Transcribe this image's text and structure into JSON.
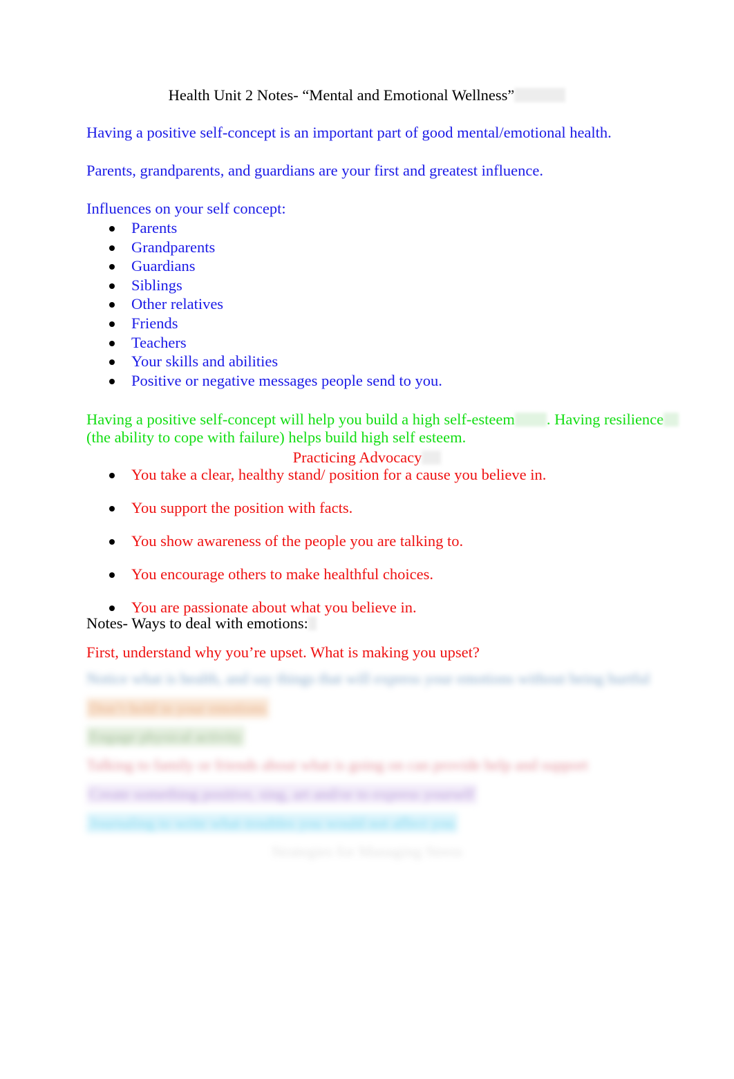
{
  "document": {
    "title": "Health Unit 2 Notes- “Mental and Emotional Wellness”",
    "intro_line": "Having a  positive self-concept    is an important part of good mental/emotional health.",
    "influence_line": "Parents, grandparents, and guardians are your first and greatest influence.",
    "influences_heading": "Influences on your self concept:",
    "influences_items": [
      "Parents",
      "Grandparents",
      "Guardians",
      "Siblings",
      "Other relatives",
      "Friends",
      "Teachers",
      "Your skills and abilities",
      "Positive or negative messages people send to you."
    ],
    "self_esteem_line_1_part_1": "Having a positive self-concept will help you build a high self-esteem",
    "self_esteem_line_1_part_2": ".  Having resilience",
    "self_esteem_line_2": "(the ability to cope with failure) helps build high self esteem.",
    "advocacy_heading": "Practicing Advocacy",
    "advocacy_items": [
      "You take a clear, healthy stand/ position for a cause you believe in.",
      "You support the position with facts.",
      "You show awareness of the people you are talking to.",
      "You encourage others to make healthful choices.",
      "You are passionate about what you believe in."
    ],
    "notes_line": "Notes-  Ways to deal with emotions:",
    "first_line": "First, understand why you’re upset. What is making you upset?",
    "redacted_lines": [
      "Notice what is health, and say things that will express your emotions without being hurtful",
      "Don’t hold in your emotions",
      "Engage physical activity",
      "Talking to family or friends about what is going on can provide help and support",
      "Create something positive, sing, art and/or to express yourself",
      "Journaling to write what troubles you would not affect you",
      "Strategies for Managing Stress"
    ]
  },
  "colors": {
    "blue_text": "#1a1ae6",
    "green_text": "#11dd11",
    "red_text": "#ee1111",
    "black_text": "#000000",
    "page_background": "#ffffff",
    "highlight_gray": "#ececec",
    "highlight_green": "#def3de"
  }
}
